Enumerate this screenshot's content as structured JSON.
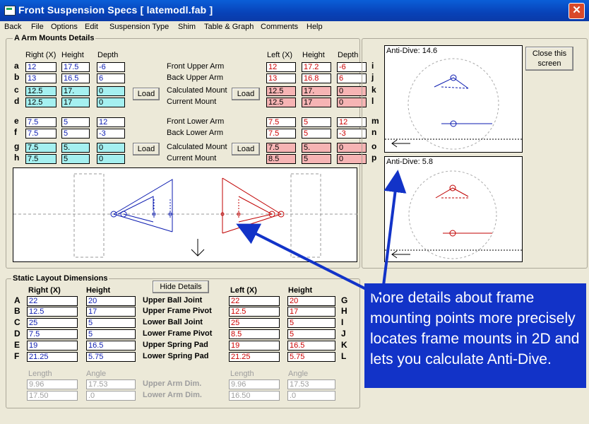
{
  "window": {
    "title": "Front Suspension Specs   [ latemodl.fab ]"
  },
  "menu": [
    "Back",
    "File",
    "Options",
    "Edit",
    "Suspension Type",
    "Shim",
    "Table & Graph",
    "Comments",
    "Help"
  ],
  "arm_mounts": {
    "title": "A Arm Mounts Details",
    "headers_right": [
      "Right (X)",
      "Height",
      "Depth"
    ],
    "headers_left": [
      "Left (X)",
      "Height",
      "Depth"
    ],
    "row_letters_left": [
      "a",
      "b",
      "c",
      "d",
      "e",
      "f",
      "g",
      "h"
    ],
    "row_letters_right": [
      "i",
      "j",
      "k",
      "l",
      "m",
      "n",
      "o",
      "p"
    ],
    "labels": [
      "Front Upper Arm",
      "Back Upper Arm",
      "Calculated Mount",
      "Current Mount",
      "Front Lower Arm",
      "Back Lower Arm",
      "Calculated Mount",
      "Current Mount"
    ],
    "right": [
      [
        "12",
        "17.5",
        "-6"
      ],
      [
        "13",
        "16.5",
        "6"
      ],
      [
        "12.5",
        "17.",
        "0"
      ],
      [
        "12.5",
        "17",
        "0"
      ],
      [
        "7.5",
        "5",
        "12"
      ],
      [
        "7.5",
        "5",
        "-3"
      ],
      [
        "7.5",
        "5.",
        "0"
      ],
      [
        "7.5",
        "5",
        "0"
      ]
    ],
    "left": [
      [
        "12",
        "17.2",
        "-6"
      ],
      [
        "13",
        "16.8",
        "6"
      ],
      [
        "12.5",
        "17.",
        "0"
      ],
      [
        "12.5",
        "17",
        "0"
      ],
      [
        "7.5",
        "5",
        "12"
      ],
      [
        "7.5",
        "5",
        "-3"
      ],
      [
        "7.5",
        "5.",
        "0"
      ],
      [
        "8.5",
        "5",
        "0"
      ]
    ],
    "load_label": "Load"
  },
  "anti_dive": {
    "top_label": "Anti-Dive: 14.6",
    "bottom_label": "Anti-Dive: 5.8",
    "close_label": "Close this screen"
  },
  "static_layout": {
    "title": "Static Layout Dimensions",
    "hide_details_label": "Hide Details",
    "headers_right": [
      "Right (X)",
      "Height"
    ],
    "headers_left": [
      "Left (X)",
      "Height"
    ],
    "row_letters_left": [
      "A",
      "B",
      "C",
      "D",
      "E",
      "F"
    ],
    "row_letters_right": [
      "G",
      "H",
      "I",
      "J",
      "K",
      "L"
    ],
    "labels": [
      "Upper Ball Joint",
      "Upper Frame Pivot",
      "Lower Ball Joint",
      "Lower Frame Pivot",
      "Upper Spring Pad",
      "Lower Spring Pad"
    ],
    "right": [
      [
        "22",
        "20"
      ],
      [
        "12.5",
        "17"
      ],
      [
        "25",
        "5"
      ],
      [
        "7.5",
        "5"
      ],
      [
        "19",
        "16.5"
      ],
      [
        "21.25",
        "5.75"
      ]
    ],
    "left": [
      [
        "22",
        "20"
      ],
      [
        "12.5",
        "17"
      ],
      [
        "25",
        "5"
      ],
      [
        "8.5",
        "5"
      ],
      [
        "19",
        "16.5"
      ],
      [
        "21.25",
        "5.75"
      ]
    ],
    "dim_headers": [
      "Length",
      "Angle"
    ],
    "dim_labels": [
      "Upper Arm Dim.",
      "Lower Arm Dim."
    ],
    "dims_right": [
      [
        "9.96",
        "17.53"
      ],
      [
        "17.50",
        ".0"
      ]
    ],
    "dims_left": [
      [
        "9.96",
        "17.53"
      ],
      [
        "16.50",
        ".0"
      ]
    ]
  },
  "callout": {
    "text": "More details about frame mounting points more precisely locates frame mounts in 2D and lets you calculate Anti-Dive."
  },
  "colors": {
    "left_blue": "#0b1bb0",
    "right_red": "#c00000",
    "cyan": "#a5f0f0",
    "pink": "#f6b4b4",
    "callout": "#1233c8"
  }
}
